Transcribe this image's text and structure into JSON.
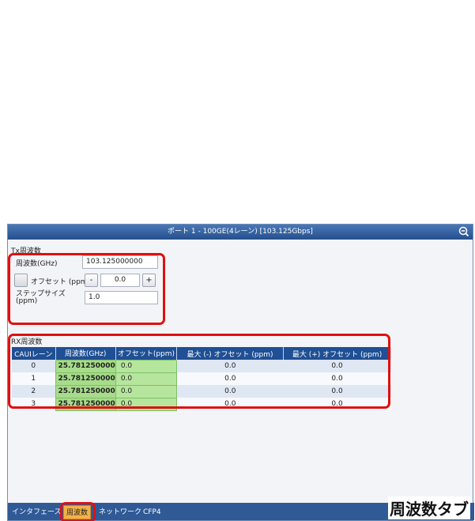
{
  "window": {
    "title": "ポート 1 - 100GE(4レーン) [103.125Gbps]",
    "zoom_icon": "zoom-out-icon"
  },
  "tx": {
    "section_label": "Tx周波数",
    "frequency_label": "周波数(GHz)",
    "frequency_value": "103.125000000",
    "offset_label": "オフセット (ppm)",
    "offset_minus": "-",
    "offset_value": "0.0",
    "offset_plus": "+",
    "step_label_line1": "ステップサイズ",
    "step_label_line2": "(ppm)",
    "step_value": "1.0"
  },
  "rx": {
    "section_label": "RX周波数",
    "columns": [
      "CAUIレーン",
      "周波数(GHz)",
      "オフセット(ppm)",
      "最大 (-) オフセット (ppm)",
      "最大 (+) オフセット (ppm)"
    ],
    "rows": [
      {
        "lane": "0",
        "freq": "25.781250000",
        "offset": "0.0",
        "max_neg": "0.0",
        "max_pos": "0.0"
      },
      {
        "lane": "1",
        "freq": "25.781250000",
        "offset": "0.0",
        "max_neg": "0.0",
        "max_pos": "0.0"
      },
      {
        "lane": "2",
        "freq": "25.781250000",
        "offset": "0.0",
        "max_neg": "0.0",
        "max_pos": "0.0"
      },
      {
        "lane": "3",
        "freq": "25.781250000",
        "offset": "0.0",
        "max_neg": "0.0",
        "max_pos": "0.0"
      }
    ]
  },
  "tabs": [
    {
      "label": "インタフェース",
      "active": false
    },
    {
      "label": "周波数",
      "active": true
    },
    {
      "label": "ネットワーク",
      "active": false
    },
    {
      "label": "CFP4",
      "active": false
    }
  ],
  "caption": "周波数タブ",
  "colors": {
    "annotation": "#e01010",
    "header": "#1f4f94",
    "active_tab": "#f1b24a",
    "value_cell": "#a7dc8b"
  }
}
